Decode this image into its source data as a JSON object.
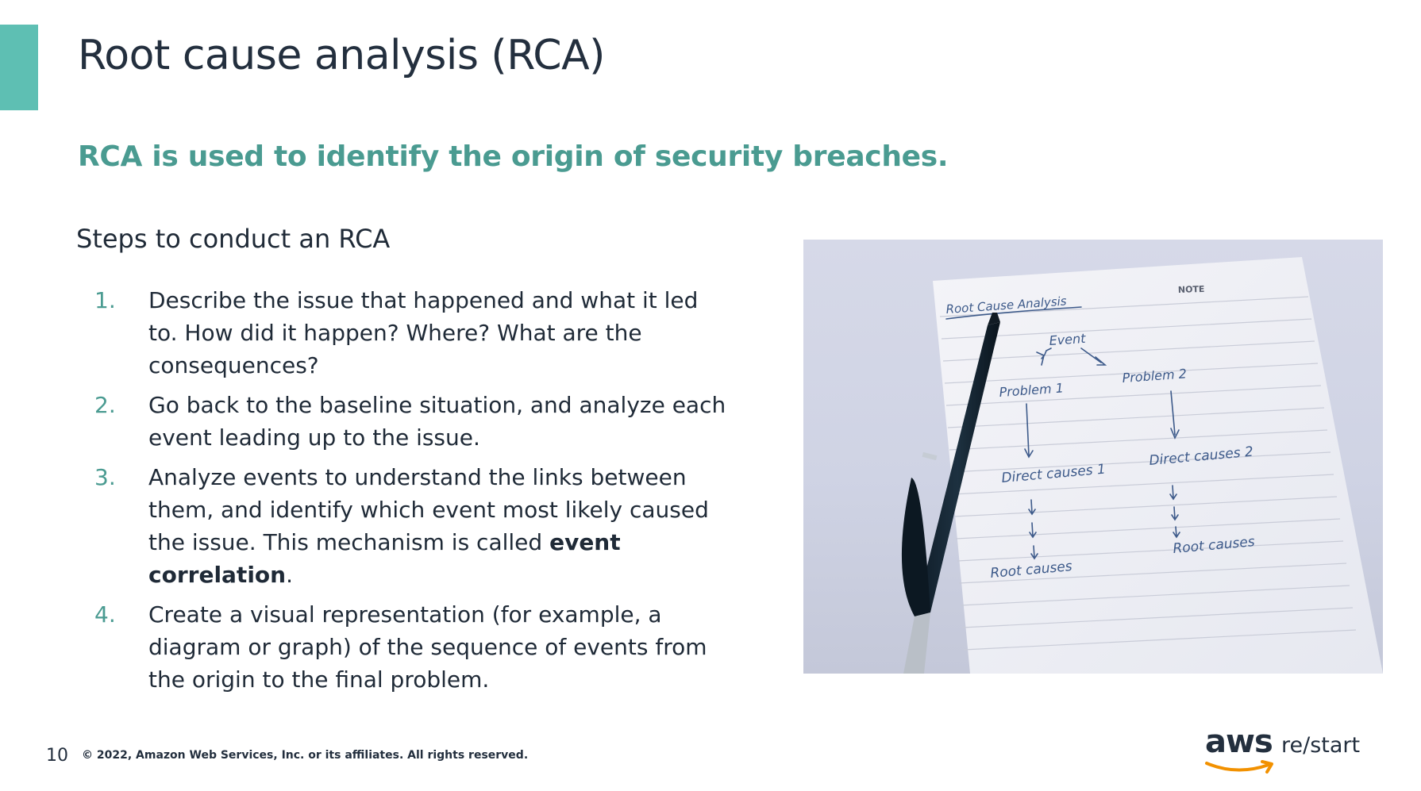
{
  "slide": {
    "title": "Root cause analysis (RCA)",
    "subtitle": "RCA is used to identify the origin of security breaches.",
    "steps_heading": "Steps to conduct an RCA"
  },
  "steps": [
    {
      "number": "1.",
      "text": "Describe the issue that happened and what it led to. How did it happen? Where? What are the consequences?"
    },
    {
      "number": "2.",
      "text": "Go back to the baseline situation, and analyze each event leading up to the issue."
    },
    {
      "number": "3.",
      "text_before": "Analyze events to understand the links between them, and identify which event most likely caused the issue. This mechanism is called ",
      "text_bold": "event correlation",
      "text_after": "."
    },
    {
      "number": "4.",
      "text": "Create a visual representation (for example, a diagram or graph) of the sequence of events from the origin to the final problem."
    }
  ],
  "photo": {
    "note_header": "NOTE",
    "note_title": "Root Cause Analysis",
    "event": "Event",
    "problem_1": "Problem 1",
    "problem_2": "Problem 2",
    "direct_causes_1": "Direct causes 1",
    "direct_causes_2": "Direct causes 2",
    "root_causes_1": "Root causes",
    "root_causes_2": "Root causes"
  },
  "footer": {
    "page_number": "10",
    "copyright": "© 2022, Amazon Web Services, Inc. or its affiliates. All rights reserved."
  },
  "logo": {
    "aws": "aws",
    "product": "re/start"
  },
  "colors": {
    "accent_bar": "#5ebfb3",
    "subtitle_teal": "#4a9b91",
    "text_dark": "#232f3e",
    "aws_orange": "#f29100",
    "ink_blue": "#3d5a8a"
  }
}
